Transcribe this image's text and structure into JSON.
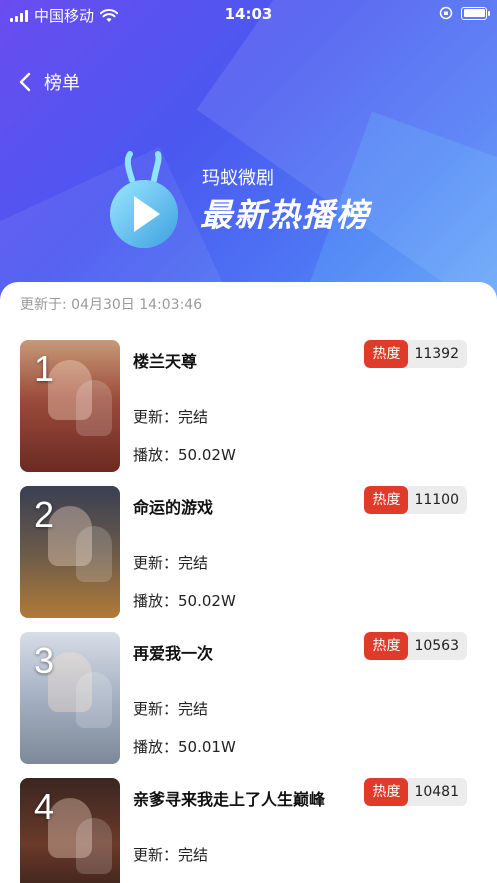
{
  "status_bar": {
    "carrier": "中国移动",
    "time": "14:03"
  },
  "nav": {
    "title": "榜单"
  },
  "banner": {
    "brand": "玛蚁微剧",
    "headline": "最新热播榜"
  },
  "updated_text": "更新于: 04月30日 14:03:46",
  "heat_label": "热度",
  "colors": {
    "accent_red": "#e03a2a",
    "banner_blue": "#4a58f0"
  },
  "items": [
    {
      "rank": "1",
      "title": "楼兰天尊",
      "heat": "11392",
      "update": "更新：完结",
      "plays": "播放：50.02W"
    },
    {
      "rank": "2",
      "title": "命运的游戏",
      "heat": "11100",
      "update": "更新：完结",
      "plays": "播放：50.02W"
    },
    {
      "rank": "3",
      "title": "再爱我一次",
      "heat": "10563",
      "update": "更新：完结",
      "plays": "播放：50.01W"
    },
    {
      "rank": "4",
      "title": "亲爹寻来我走上了人生巅峰",
      "heat": "10481",
      "update": "更新：完结",
      "plays": ""
    }
  ]
}
